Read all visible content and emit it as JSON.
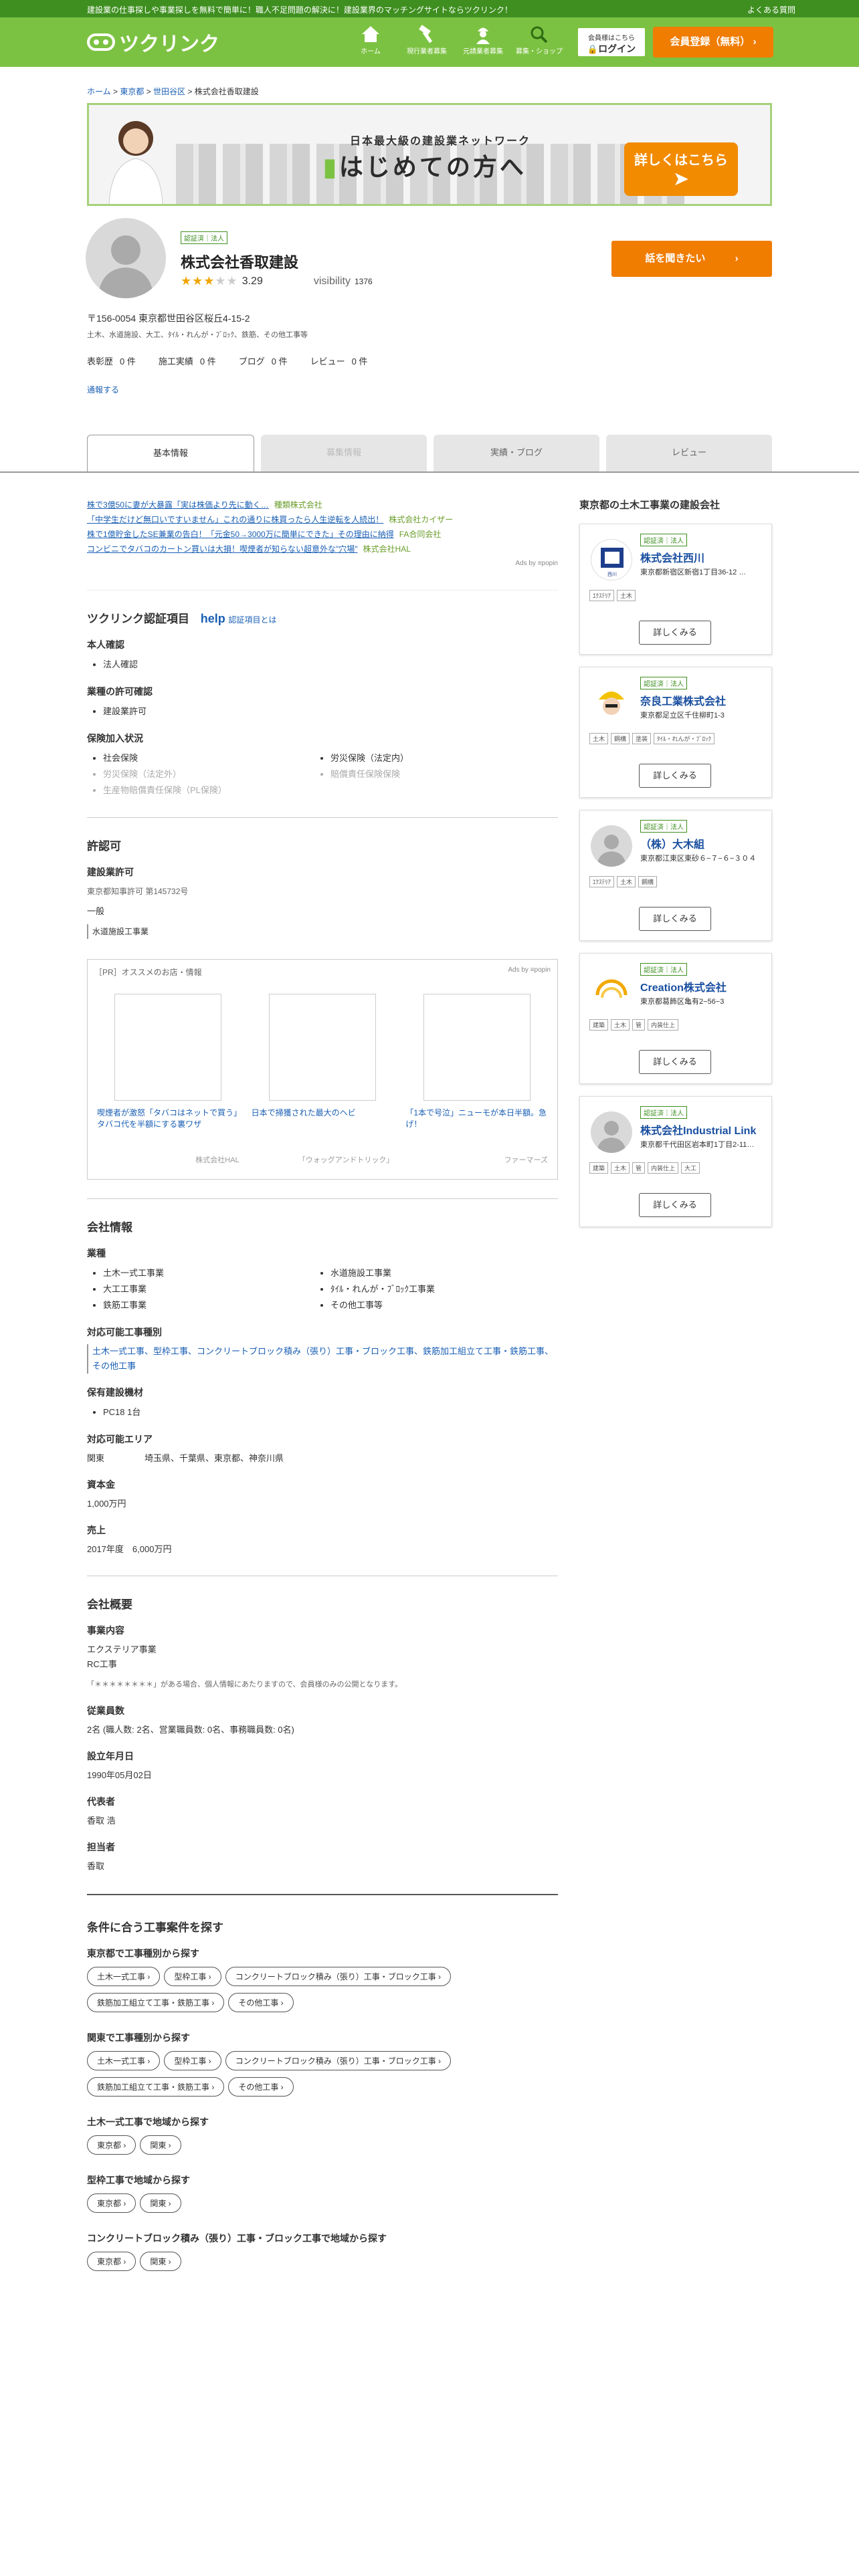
{
  "topbar": {
    "message": "建設業の仕事探しや事業探しを無料で簡単に！職人不足問題の解決に！建設業界のマッチングサイトならツクリンク！",
    "faq": "よくある質問"
  },
  "header": {
    "logo": "ツクリンク",
    "nav": [
      {
        "label": "ホーム",
        "icon": "home-icon"
      },
      {
        "label": "現行業者募集",
        "icon": "hammer-icon"
      },
      {
        "label": "元請業者募集",
        "icon": "worker-icon"
      },
      {
        "label": "募集・ショップ",
        "icon": "search-icon"
      }
    ],
    "login_small": "会員様はこちら",
    "login": "ログイン",
    "register": "会員登録（無料）"
  },
  "breadcrumb": [
    "ホーム",
    "東京都",
    "世田谷区",
    "株式会社香取建設"
  ],
  "banner": {
    "tagline": "日本最大級の建設業ネットワーク",
    "headline": "はじめての方へ",
    "cta": "詳しくはこちら"
  },
  "profile": {
    "badge": "認証済｜法人",
    "name": "株式会社香取建設",
    "rating": "3.29",
    "visibility_label": "visibility",
    "visibility": "1376",
    "talk_button": "話を聞きたい",
    "address": "〒156-0054 東京都世田谷区桜丘4-15-2",
    "categories": "土木、水道施設、大工、ﾀｲﾙ・れんが・ﾌﾞﾛｯｸ、鉄筋、その他工事等",
    "stats": [
      {
        "label": "表彰歴",
        "value": "0 件"
      },
      {
        "label": "施工実績",
        "value": "0 件"
      },
      {
        "label": "ブログ",
        "value": "0 件"
      },
      {
        "label": "レビュー",
        "value": "0 件"
      }
    ],
    "report": "通報する"
  },
  "tabs": [
    "基本情報",
    "募集情報",
    "実績・ブログ",
    "レビュー"
  ],
  "ads": [
    {
      "text": "株で3億50に妻が大暴露「実は株価より先に動く…",
      "sponsor": "種類株式会社"
    },
    {
      "text": "「中学生だけど無口いですいません」これの通りに株買ったら人生逆転を人続出！",
      "sponsor": "株式会社カイザー"
    },
    {
      "text": "株で1億貯金したSE兼業の告白！「元金50→3000万に簡単にできた」その理由に納得",
      "sponsor": "FA合同会社"
    },
    {
      "text": "コンビニでタバコのカートン買いは大損！喫煙者が知らない超意外な\"穴場\"",
      "sponsor": "株式会社HAL"
    }
  ],
  "adby": "Ads by ≡popin",
  "cert": {
    "title": "ツクリンク認証項目",
    "help_icon": "help",
    "help_link": "認証項目とは",
    "identity": "本人確認",
    "identity_items": [
      "法人確認"
    ],
    "license": "業種の許可確認",
    "license_items": [
      "建設業許可"
    ],
    "insurance": "保険加入状況",
    "insurance_items": [
      "社会保険",
      "労災保険（法定内）",
      "労災保険（法定外）",
      "賠償責任保険保険",
      "生産物賠償責任保険（PL保険）"
    ]
  },
  "permit": {
    "title": "許認可",
    "sub": "建設業許可",
    "number": "東京都知事許可 第145732号",
    "type": "一般",
    "work": "水道施設工事業"
  },
  "pr": {
    "label": "［PR］オススメのお店・情報",
    "adby": "Ads by ≡popin",
    "cards": [
      {
        "title": "喫煙者が激怒「タバコはネットで買う」タバコ代を半額にする裏ワザ",
        "source": "株式会社HAL"
      },
      {
        "title": "日本で掃獲された最大のヘビ",
        "source": "「ウォッグアンドトリック」"
      },
      {
        "title": "「1本で号泣」ニューモが本日半額。急げ！",
        "source": "ファーマーズ"
      }
    ]
  },
  "company": {
    "title": "会社情報",
    "industries_label": "業種",
    "industries": [
      "土木一式工事業",
      "水道施設工事業",
      "大工工事業",
      "ﾀｲﾙ・れんが・ﾌﾞﾛｯｸ工事業",
      "鉄筋工事業",
      "その他工事等"
    ],
    "work_types_label": "対応可能工事種別",
    "work_types": "土木一式工事、型枠工事、コンクリートブロック積み（張り）工事・ブロック工事、鉄筋加工組立て工事・鉄筋工事、その他工事",
    "machines_label": "保有建設機材",
    "machines": [
      "PC18 1台"
    ],
    "area_label": "対応可能エリア",
    "area_region": "関東",
    "area_value": "埼玉県、千葉県、東京都、神奈川県",
    "capital_label": "資本金",
    "capital": "1,000万円",
    "sales_label": "売上",
    "sales": "2017年度　6,000万円"
  },
  "overview": {
    "title": "会社概要",
    "business_label": "事業内容",
    "business": [
      "エクステリア事業",
      "RC工事"
    ],
    "note": "「＊＊＊＊＊＊＊＊」がある場合、個人情報にあたりますので、会員様のみの公開となります。",
    "employees_label": "従業員数",
    "employees": "2名 (職人数: 2名、営業職員数: 0名、事務職員数: 0名)",
    "founded_label": "設立年月日",
    "founded": "1990年05月02日",
    "rep_label": "代表者",
    "rep": "香取 浩",
    "contact_label": "担当者",
    "contact": "香取"
  },
  "search": {
    "title": "条件に合う工事案件を探す",
    "groups": [
      {
        "label": "東京都で工事種別から探す",
        "chips": [
          "土木一式工事 ›",
          "型枠工事 ›",
          "コンクリートブロック積み（張り）工事・ブロック工事 ›",
          "鉄筋加工組立て工事・鉄筋工事 ›",
          "その他工事 ›"
        ]
      },
      {
        "label": "関東で工事種別から探す",
        "chips": [
          "土木一式工事 ›",
          "型枠工事 ›",
          "コンクリートブロック積み（張り）工事・ブロック工事 ›",
          "鉄筋加工組立て工事・鉄筋工事 ›",
          "その他工事 ›"
        ]
      },
      {
        "label": "土木一式工事で地域から探す",
        "chips": [
          "東京都 ›",
          "関東 ›"
        ]
      },
      {
        "label": "型枠工事で地域から探す",
        "chips": [
          "東京都 ›",
          "関東 ›"
        ]
      },
      {
        "label": "コンクリートブロック積み（張り）工事・ブロック工事で地域から探す",
        "chips": [
          "東京都 ›",
          "関東 ›"
        ]
      }
    ]
  },
  "sidebar": {
    "title": "東京都の土木工事業の建設会社",
    "companies": [
      {
        "badge": "認証済｜法人",
        "name": "株式会社西川",
        "address": "東京都新宿区新宿1丁目36-12 …",
        "tags": [
          "ｴｸｽﾃﾘｱ",
          "土木"
        ],
        "more": "詳しくみる",
        "logo": "nishikawa-logo"
      },
      {
        "badge": "認証済｜法人",
        "name": "奈良工業株式会社",
        "address": "東京都足立区千住柳町1-3",
        "tags": [
          "土木",
          "鋼構",
          "塗装",
          "ﾀｲﾙ・れんが・ﾌﾞﾛｯｸ"
        ],
        "more": "詳しくみる",
        "logo": "nara-logo"
      },
      {
        "badge": "認証済｜法人",
        "name": "（株）大木組",
        "address": "東京都江東区東砂６−７−６−３０４",
        "tags": [
          "ｴｸｽﾃﾘｱ",
          "土木",
          "鋼構"
        ],
        "more": "詳しくみる",
        "logo": "default-avatar"
      },
      {
        "badge": "認証済｜法人",
        "name": "Creation株式会社",
        "address": "東京都葛飾区亀有2−56−3",
        "tags": [
          "建築",
          "土木",
          "管",
          "内装仕上"
        ],
        "more": "詳しくみる",
        "logo": "creation-logo"
      },
      {
        "badge": "認証済｜法人",
        "name": "株式会社Industrial Link",
        "address": "東京都千代田区岩本町1丁目2-11…",
        "tags": [
          "建築",
          "土木",
          "管",
          "内装仕上",
          "大工"
        ],
        "more": "詳しくみる",
        "logo": "default-avatar"
      }
    ]
  },
  "colors": {
    "brand_green": "#7cc242",
    "dark_green": "#3e8f1f",
    "orange": "#f07c00",
    "link": "#1a5fb4"
  }
}
